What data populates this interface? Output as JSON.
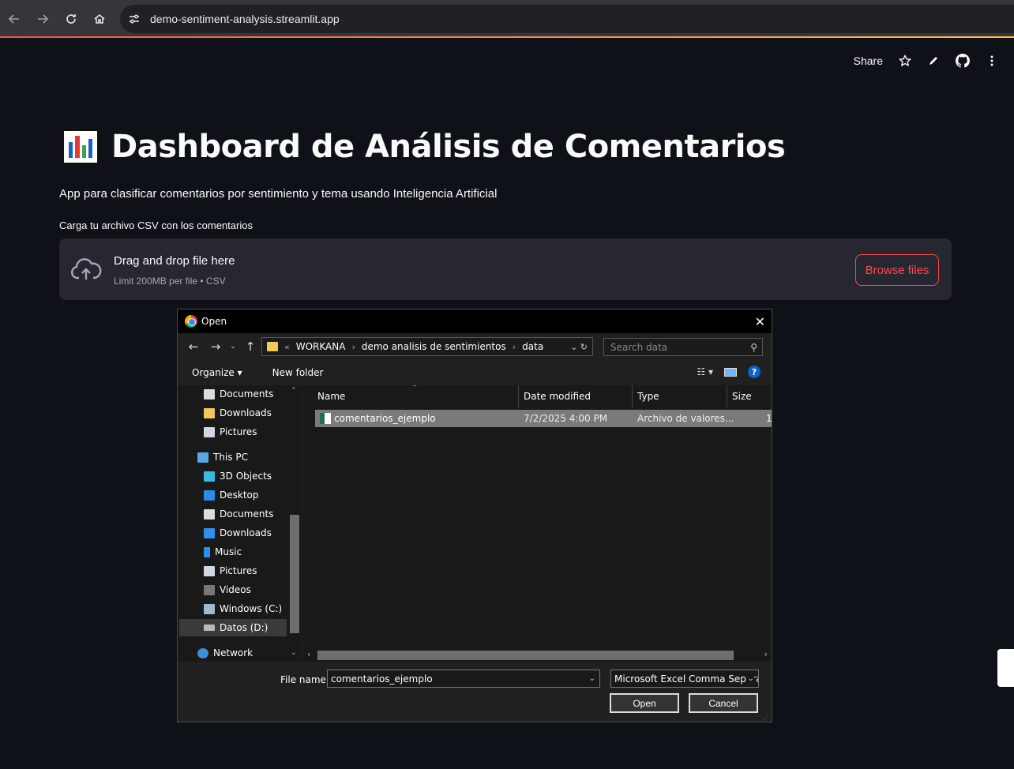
{
  "browser": {
    "url": "demo-sentiment-analysis.streamlit.app"
  },
  "app": {
    "share_label": "Share",
    "title": "Dashboard de Análisis de Comentarios",
    "subtitle": "App para clasificar comentarios por sentimiento y tema usando Inteligencia Artificial",
    "uploader_label": "Carga tu archivo CSV con los comentarios",
    "dropzone_title": "Drag and drop file here",
    "dropzone_limit": "Limit 200MB per file • CSV",
    "browse_label": "Browse files",
    "accent_color": "#ff4b4b"
  },
  "dialog": {
    "title": "Open",
    "breadcrumb": [
      "«",
      "WORKANA",
      "demo analisis de sentimientos",
      "data"
    ],
    "search_placeholder": "Search data",
    "organize_label": "Organize ▾",
    "new_folder_label": "New folder",
    "nav_items": [
      {
        "label": "Documents",
        "icon": "documents-icon"
      },
      {
        "label": "Downloads",
        "icon": "folder-icon"
      },
      {
        "label": "Pictures",
        "icon": "pictures-icon"
      },
      {
        "label": "This PC",
        "icon": "computer-icon"
      },
      {
        "label": "3D Objects",
        "icon": "cube-icon"
      },
      {
        "label": "Desktop",
        "icon": "desktop-icon"
      },
      {
        "label": "Documents",
        "icon": "documents-icon"
      },
      {
        "label": "Downloads",
        "icon": "download-icon"
      },
      {
        "label": "Music",
        "icon": "music-icon"
      },
      {
        "label": "Pictures",
        "icon": "pictures-icon"
      },
      {
        "label": "Videos",
        "icon": "videos-icon"
      },
      {
        "label": "Windows (C:)",
        "icon": "drive-icon"
      },
      {
        "label": "Datos (D:)",
        "icon": "drive-icon"
      },
      {
        "label": "Network",
        "icon": "network-icon"
      }
    ],
    "columns": [
      "Name",
      "Date modified",
      "Type",
      "Size"
    ],
    "files": [
      {
        "name": "comentarios_ejemplo",
        "date": "7/2/2025 4:00 PM",
        "type": "Archivo de valores...",
        "size": "1"
      }
    ],
    "file_name_label": "File name:",
    "file_name_value": "comentarios_ejemplo",
    "file_type_value": "Microsoft Excel Comma Separa",
    "open_label": "Open",
    "cancel_label": "Cancel"
  }
}
